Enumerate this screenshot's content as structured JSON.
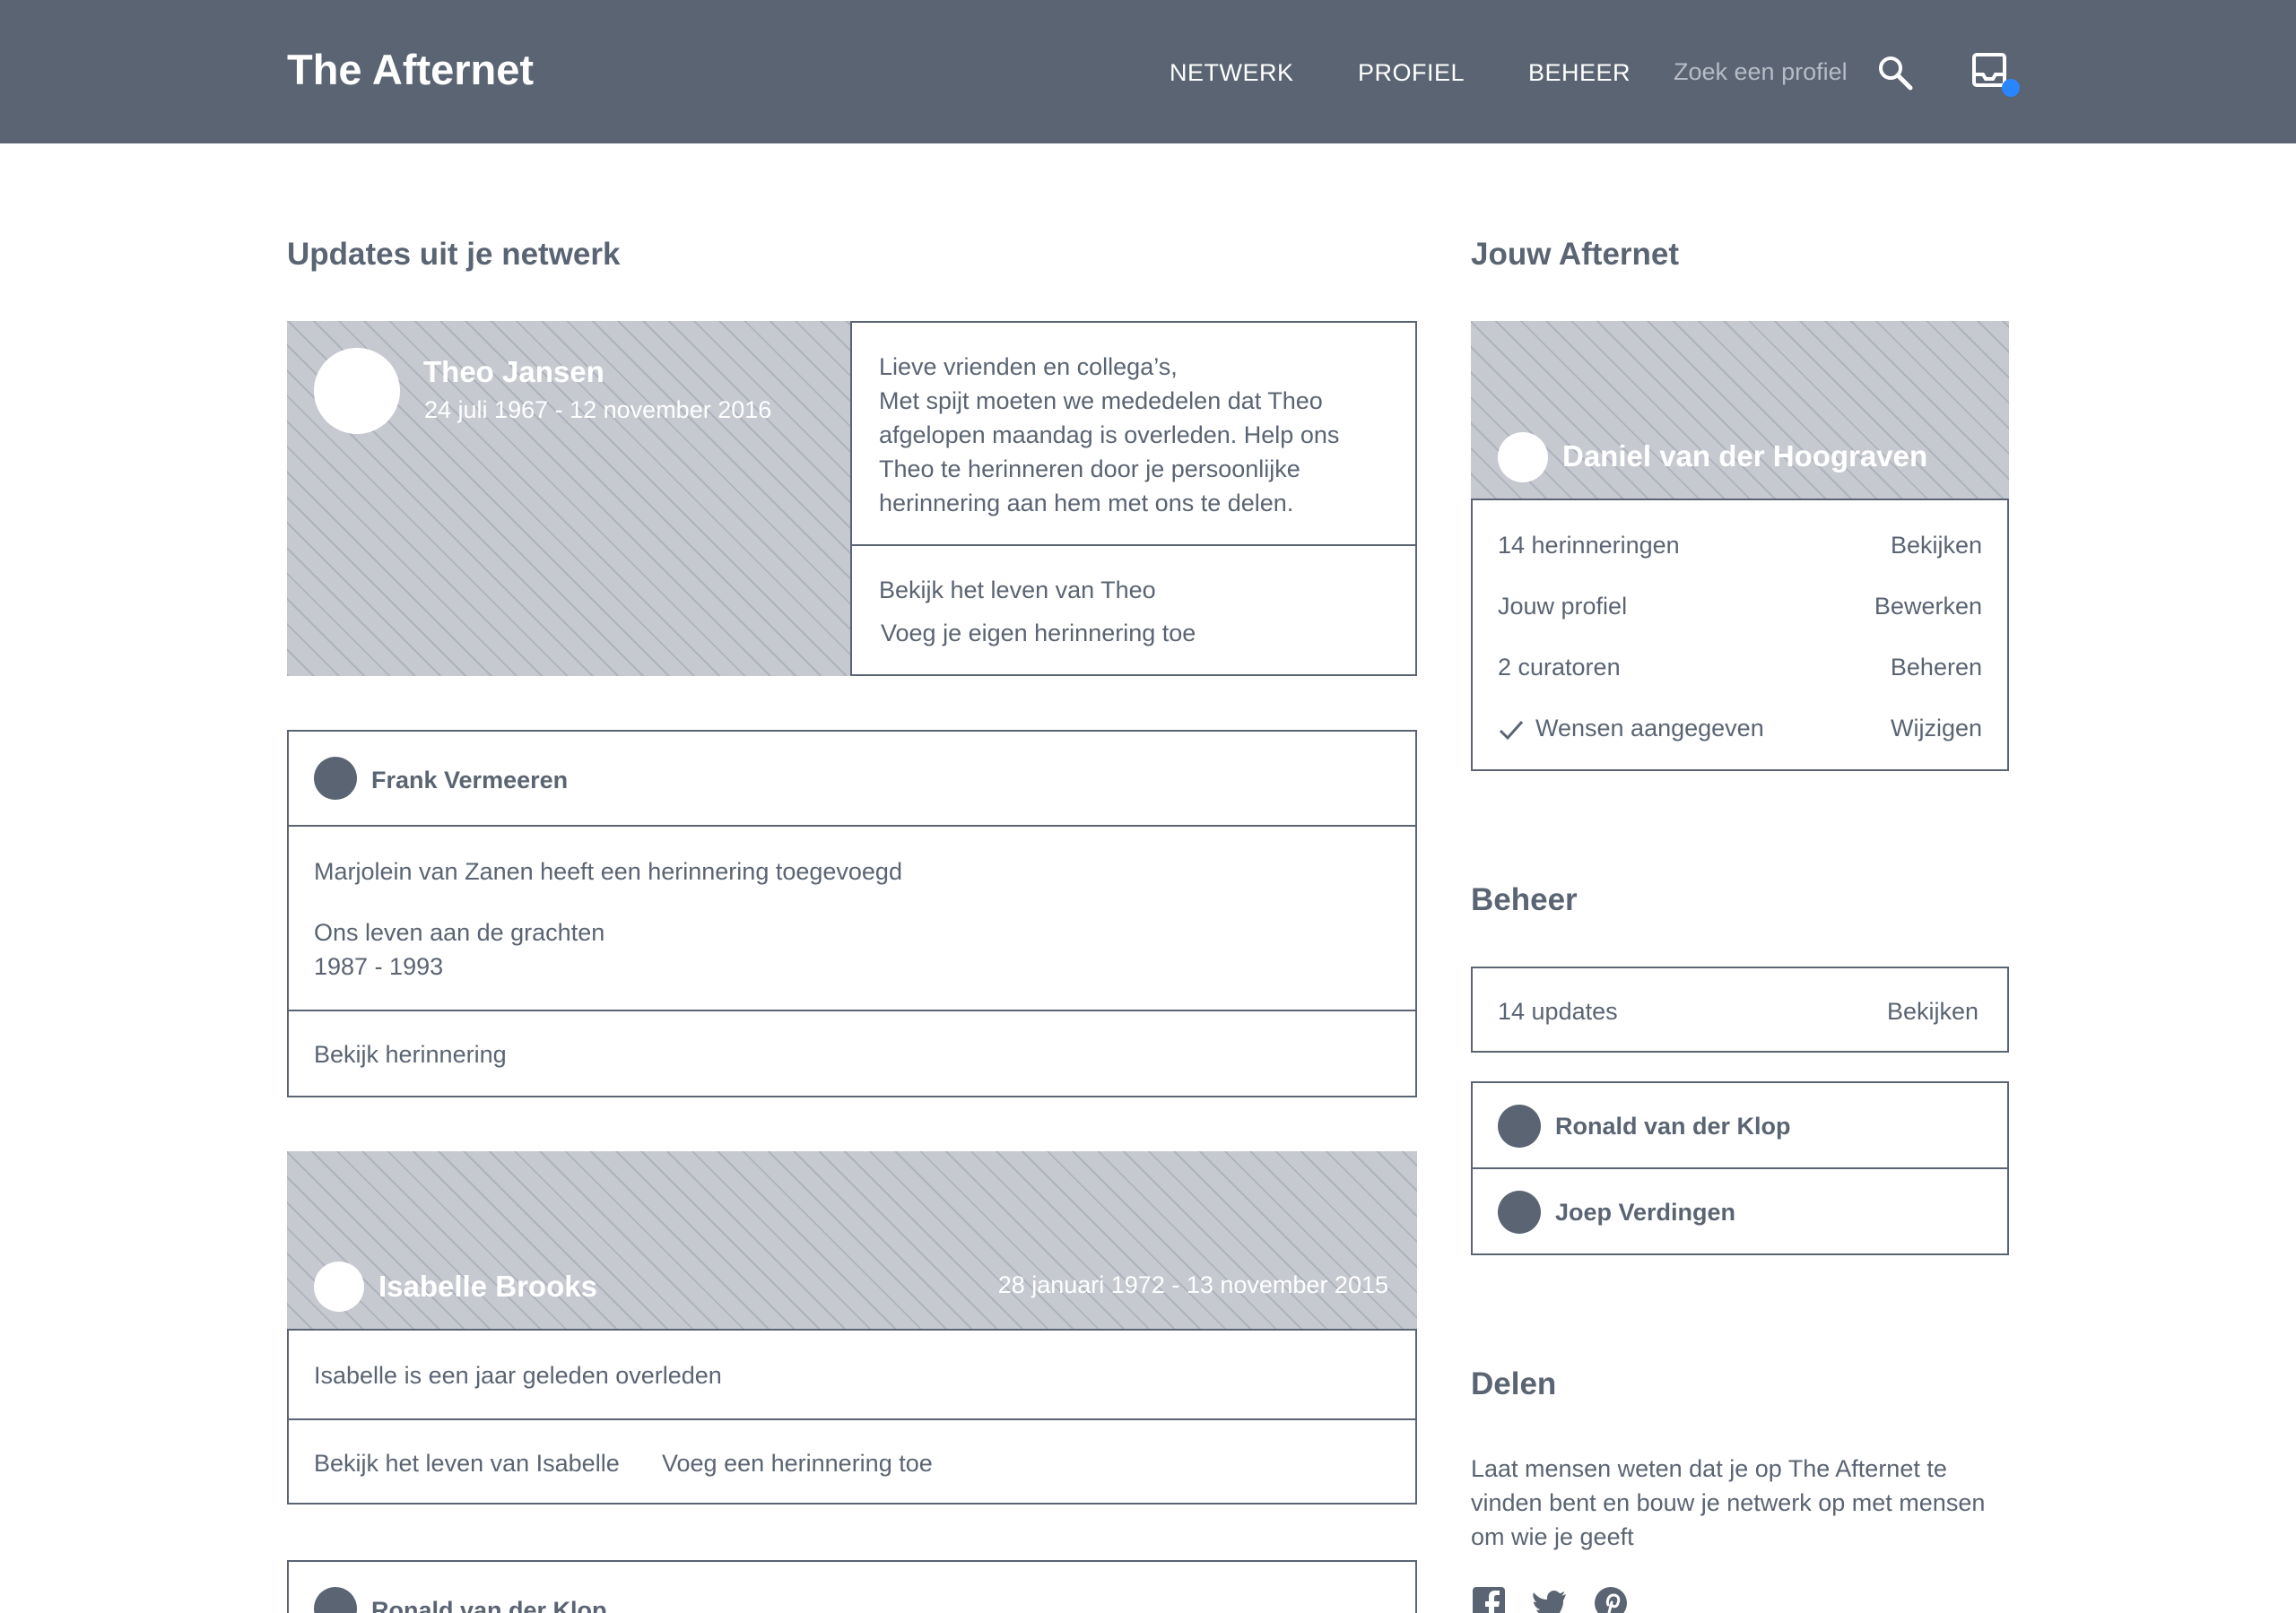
{
  "header": {
    "logo": "The Afternet",
    "nav": [
      "NETWERK",
      "PROFIEL",
      "BEHEER"
    ],
    "search_placeholder": "Zoek een profiel",
    "search_icon": "search-icon",
    "inbox_icon": "inbox-icon",
    "colors": {
      "bar": "#5a6472",
      "notification": "#2a86ff"
    }
  },
  "feed": {
    "title": "Updates uit je netwerk",
    "theo": {
      "name": "Theo Jansen",
      "dates": "24 juli 1967 - 12 november 2016",
      "message": [
        "Lieve vrienden en collega’s,",
        "Met spijt moeten we mededelen dat Theo",
        "afgelopen maandag is overleden. Help ons",
        "Theo te herinneren door je persoonlijke",
        "herinnering aan hem met ons te delen."
      ],
      "view_life": "Bekijk het leven van Theo",
      "add_memory": "Voeg je eigen herinnering toe"
    },
    "frank": {
      "name": "Frank Vermeeren",
      "activity": "Marjolein van Zanen heeft een herinnering toegevoegd",
      "memory_title": "Ons leven aan de grachten",
      "memory_years": "1987 - 1993",
      "view_memory": "Bekijk herinnering"
    },
    "isabelle": {
      "name": "Isabelle Brooks",
      "dates": "28 januari 1972 - 13 november 2015",
      "note": "Isabelle is een jaar geleden overleden",
      "view_life": "Bekijk het leven van Isabelle",
      "add_memory": "Voeg een herinnering toe"
    },
    "ronald": {
      "name": "Ronald van der Klop"
    }
  },
  "sidebar": {
    "afternet": {
      "title": "Jouw Afternet",
      "name": "Daniel van der Hoograven",
      "rows": [
        {
          "label": "14 herinneringen",
          "action": "Bekijken"
        },
        {
          "label": "Jouw profiel",
          "action": "Bewerken"
        },
        {
          "label": "2 curatoren",
          "action": "Beheren"
        },
        {
          "label": "Wensen aangegeven",
          "action": "Wijzigen",
          "icon": "check-icon"
        }
      ]
    },
    "beheer": {
      "title": "Beheer",
      "updates_label": "14 updates",
      "updates_action": "Bekijken",
      "people": [
        "Ronald van der Klop",
        "Joep Verdingen"
      ]
    },
    "delen": {
      "title": "Delen",
      "text": [
        "Laat mensen weten dat je op The Afternet te",
        "vinden bent en bouw je netwerk op met mensen",
        "om wie je geeft"
      ],
      "socials": [
        "facebook-icon",
        "twitter-icon",
        "pinterest-icon"
      ]
    }
  }
}
